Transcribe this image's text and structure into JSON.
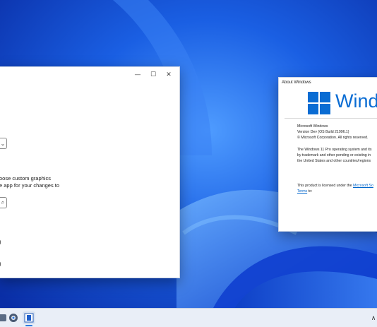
{
  "settings_window": {
    "line1": "oose custom graphics",
    "line2": "e app for your changes to",
    "item1": ")",
    "item2": ")",
    "minimize_glyph": "—",
    "maximize_glyph": "☐",
    "close_glyph": "✕",
    "dropdown_glyph": "⌄",
    "search_glyph": "⌕"
  },
  "about_window": {
    "title": "About Windows",
    "logo_text": "Windo",
    "product": "Microsoft Windows",
    "version": "Version Dev (OS Build 21996.1)",
    "copyright": "© Microsoft Corporation. All rights reserved.",
    "para1_line1": "The Windows 11 Pro operating system and its",
    "para1_line2": "by trademark and other pending or existing in",
    "para1_line3": "the United States and other countries/regions",
    "license_prefix": "This product is licensed under the ",
    "license_link1": "Microsoft So",
    "license_link2": "Terms",
    "license_suffix": " to:"
  },
  "taskbar": {
    "chevron_glyph": "∧",
    "icons": [
      "app-icon",
      "settings-gear-icon",
      "about-window-icon"
    ]
  },
  "colors": {
    "accent": "#0a6cd3",
    "wallpaper": "#1b5fe0",
    "taskbar": "#e9eef7"
  }
}
